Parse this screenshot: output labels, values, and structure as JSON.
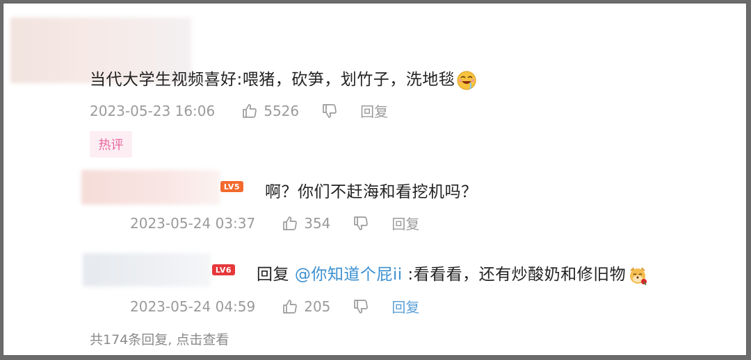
{
  "comment": {
    "text": "当代大学生视频喜好:喂猪，砍笋，划竹子，洗地毯",
    "emoji": "laughing-drooling-emoji",
    "date": "2023-05-23 16:06",
    "likes": "5526",
    "reply_label": "回复",
    "badge": "热评"
  },
  "replies": [
    {
      "level": "LV5",
      "level_color": "#f26a2e",
      "text": "啊？你们不赶海和看挖机吗？",
      "date": "2023-05-24 03:37",
      "likes": "354",
      "reply_label": "回复"
    },
    {
      "level": "LV6",
      "level_color": "#e5383b",
      "prefix": "回复",
      "mention": "@你知道个屁ii",
      "text": ":看看看，还有炒酸奶和修旧物",
      "emoji": "dog-rose-emoji",
      "date": "2023-05-24 04:59",
      "likes": "205",
      "reply_label": "回复"
    }
  ],
  "more_replies": "共174条回复, 点击查看"
}
